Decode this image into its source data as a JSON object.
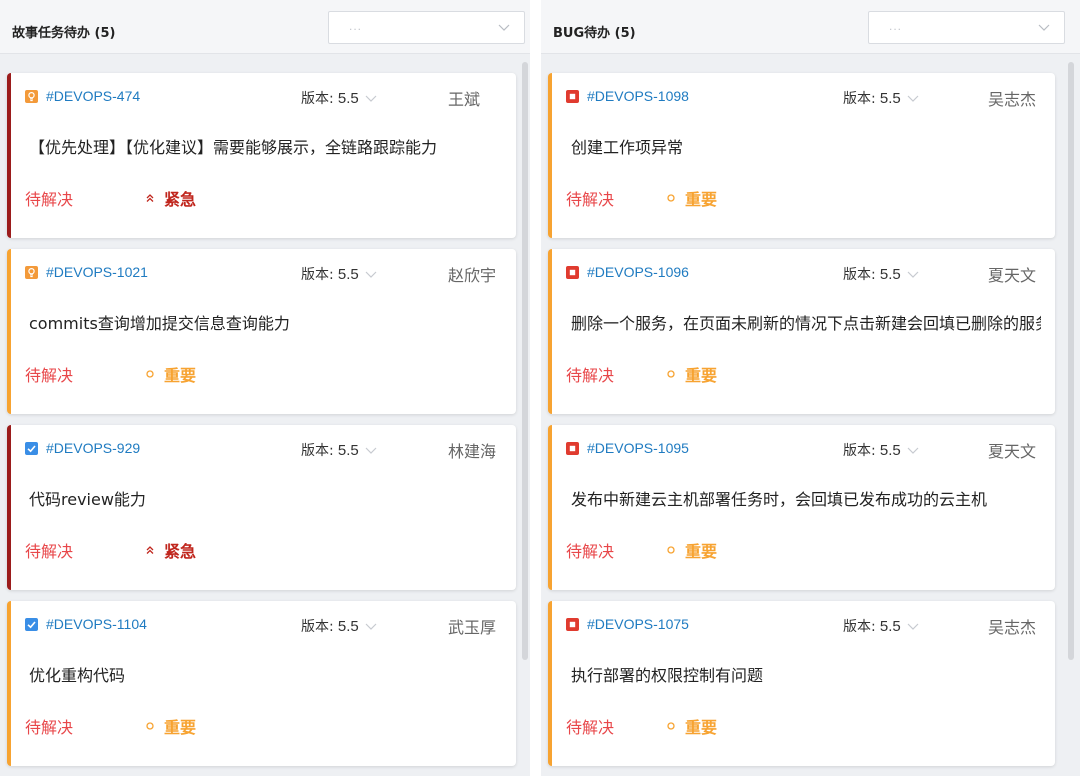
{
  "colors": {
    "urgent": "#c0261d",
    "important": "#f7a331",
    "status": "#e8474a",
    "link": "#1f7bc1",
    "story_icon": "#f39a3a",
    "task_icon": "#3a8ee6",
    "bug_icon": "#e03b2f"
  },
  "left_panel": {
    "title": "故事任务待办 (5)",
    "filter_placeholder": "...",
    "cards": [
      {
        "icon": "lightbulb-icon",
        "id": "#DEVOPS-474",
        "version_label": "版本:",
        "version": "5.5",
        "assignee": "王斌",
        "title": "【优先处理】【优化建议】需要能够展示，全链路跟踪能力",
        "status": "待解决",
        "priority": "紧急",
        "priority_icon": "double-chevron-up-icon"
      },
      {
        "icon": "lightbulb-icon",
        "id": "#DEVOPS-1021",
        "version_label": "版本:",
        "version": "5.5",
        "assignee": "赵欣宇",
        "title": "commits查询增加提交信息查询能力",
        "status": "待解决",
        "priority": "重要",
        "priority_icon": "circle-icon"
      },
      {
        "icon": "checkbox-icon",
        "id": "#DEVOPS-929",
        "version_label": "版本:",
        "version": "5.5",
        "assignee": "林建海",
        "title": "代码review能力",
        "status": "待解决",
        "priority": "紧急",
        "priority_icon": "double-chevron-up-icon"
      },
      {
        "icon": "checkbox-icon",
        "id": "#DEVOPS-1104",
        "version_label": "版本:",
        "version": "5.5",
        "assignee": "武玉厚",
        "title": "优化重构代码",
        "status": "待解决",
        "priority": "重要",
        "priority_icon": "circle-icon"
      }
    ]
  },
  "right_panel": {
    "title": "BUG待办 (5)",
    "filter_placeholder": "...",
    "cards": [
      {
        "icon": "bug-icon",
        "id": "#DEVOPS-1098",
        "version_label": "版本:",
        "version": "5.5",
        "assignee": "吴志杰",
        "title": "创建工作项异常",
        "status": "待解决",
        "priority": "重要",
        "priority_icon": "circle-icon"
      },
      {
        "icon": "bug-icon",
        "id": "#DEVOPS-1096",
        "version_label": "版本:",
        "version": "5.5",
        "assignee": "夏天文",
        "title": "删除一个服务，在页面未刷新的情况下点击新建会回填已删除的服务",
        "status": "待解决",
        "priority": "重要",
        "priority_icon": "circle-icon"
      },
      {
        "icon": "bug-icon",
        "id": "#DEVOPS-1095",
        "version_label": "版本:",
        "version": "5.5",
        "assignee": "夏天文",
        "title": "发布中新建云主机部署任务时，会回填已发布成功的云主机",
        "status": "待解决",
        "priority": "重要",
        "priority_icon": "circle-icon"
      },
      {
        "icon": "bug-icon",
        "id": "#DEVOPS-1075",
        "version_label": "版本:",
        "version": "5.5",
        "assignee": "吴志杰",
        "title": "执行部署的权限控制有问题",
        "status": "待解决",
        "priority": "重要",
        "priority_icon": "circle-icon"
      }
    ]
  }
}
